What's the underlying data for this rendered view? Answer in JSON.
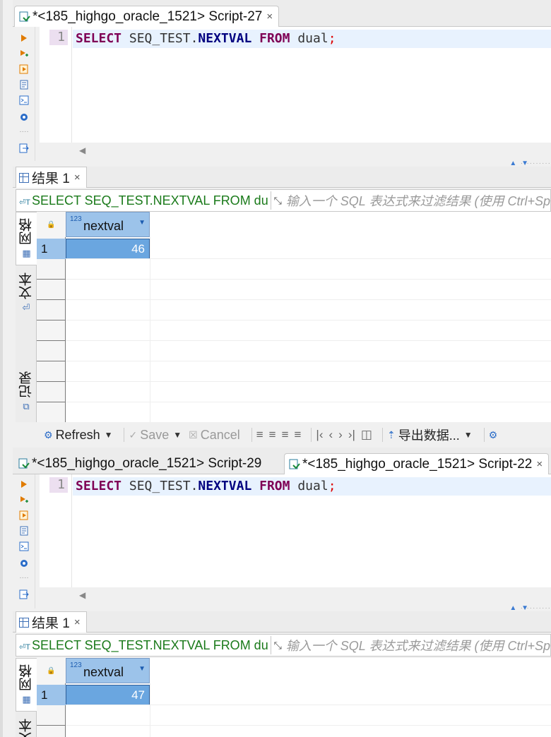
{
  "top": {
    "editor_tabs": [
      {
        "label": "*<185_highgo_oracle_1521> Script-27",
        "close": "×"
      }
    ],
    "sql": {
      "line_number": "1",
      "tokens": {
        "select": "SELECT",
        "seq": "SEQ_TEST.",
        "nextval": "NEXTVAL",
        "from": "FROM",
        "table": "dual",
        "semi": ";"
      }
    },
    "result_tab": {
      "label": "结果 1",
      "close": "×"
    },
    "filter": {
      "query": "SELECT SEQ_TEST.NEXTVAL FROM dua",
      "placeholder": "输入一个 SQL 表达式来过滤结果 (使用 Ctrl+Sp"
    },
    "vertical_tabs": {
      "grid": "网格",
      "text": "文本",
      "record": "记录"
    },
    "grid": {
      "type_badge": "123",
      "column": "nextval",
      "rows": [
        {
          "num": "1",
          "value": "46"
        }
      ]
    },
    "toolbar": {
      "refresh": "Refresh",
      "save": "Save",
      "cancel": "Cancel",
      "export": "导出数据..."
    }
  },
  "bottom": {
    "editor_tabs": [
      {
        "label": "*<185_highgo_oracle_1521> Script-29"
      },
      {
        "label": "*<185_highgo_oracle_1521> Script-22",
        "close": "×"
      }
    ],
    "sql": {
      "line_number": "1",
      "tokens": {
        "select": "SELECT",
        "seq": "SEQ_TEST.",
        "nextval": "NEXTVAL",
        "from": "FROM",
        "table": "dual",
        "semi": ";"
      }
    },
    "result_tab": {
      "label": "结果 1",
      "close": "×"
    },
    "filter": {
      "query": "SELECT SEQ_TEST.NEXTVAL FROM dua",
      "placeholder": "输入一个 SQL 表达式来过滤结果 (使用 Ctrl+Sp"
    },
    "vertical_tabs": {
      "grid": "网格",
      "text": "文本"
    },
    "grid": {
      "type_badge": "123",
      "column": "nextval",
      "rows": [
        {
          "num": "1",
          "value": "47"
        }
      ]
    }
  },
  "colors": {
    "keyword": "#7f0055",
    "function": "#000080",
    "selection": "#6aa6e0",
    "header": "#9cc3ea",
    "filter_text": "#1a7a1a"
  }
}
